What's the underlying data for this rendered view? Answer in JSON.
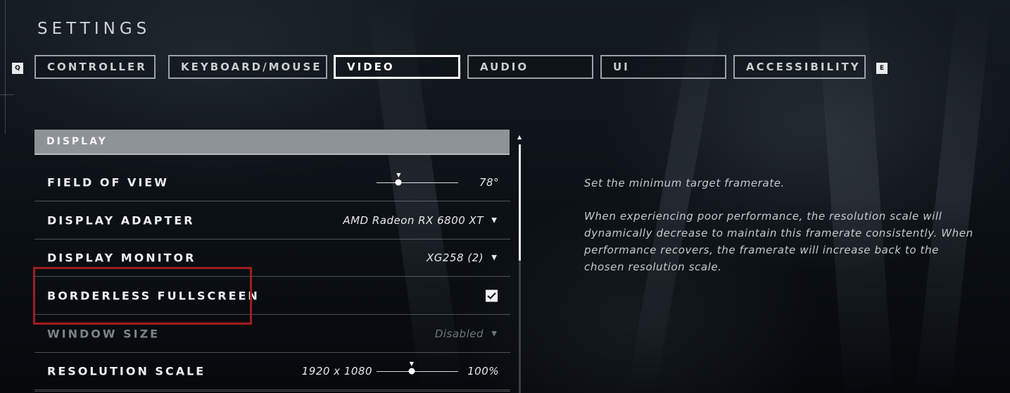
{
  "page": {
    "title": "SETTINGS"
  },
  "keys": {
    "prev": "Q",
    "next": "E"
  },
  "tabs": [
    {
      "label": "CONTROLLER",
      "active": false
    },
    {
      "label": "KEYBOARD/MOUSE",
      "active": false
    },
    {
      "label": "VIDEO",
      "active": true
    },
    {
      "label": "AUDIO",
      "active": false
    },
    {
      "label": "UI",
      "active": false
    },
    {
      "label": "ACCESSIBILITY",
      "active": false
    }
  ],
  "section": {
    "title": "DISPLAY"
  },
  "rows": {
    "field_of_view": {
      "label": "FIELD OF VIEW",
      "value": "78°",
      "slider_fraction": 0.27
    },
    "display_adapter": {
      "label": "DISPLAY ADAPTER",
      "value": "AMD Radeon RX 6800 XT"
    },
    "display_monitor": {
      "label": "DISPLAY MONITOR",
      "value": "XG258 (2)"
    },
    "borderless_fullscreen": {
      "label": "BORDERLESS FULLSCREEN",
      "checked": true
    },
    "window_size": {
      "label": "WINDOW SIZE",
      "value": "Disabled",
      "disabled": true
    },
    "resolution_scale": {
      "label": "RESOLUTION SCALE",
      "resolution": "1920 x 1080",
      "value": "100%",
      "slider_fraction": 0.43
    }
  },
  "description": {
    "line1": "Set the minimum target framerate.",
    "para2_line1": "When experiencing poor performance, the resolution scale will",
    "para2_line2": "dynamically decrease to maintain this framerate consistently. When",
    "para2_line3": "performance recovers, the framerate will increase back to the",
    "para2_line4": "chosen resolution scale."
  },
  "colors": {
    "highlight": "#a11d1f",
    "section_header": "#8e9397",
    "active_tab_border": "#ffffff"
  }
}
